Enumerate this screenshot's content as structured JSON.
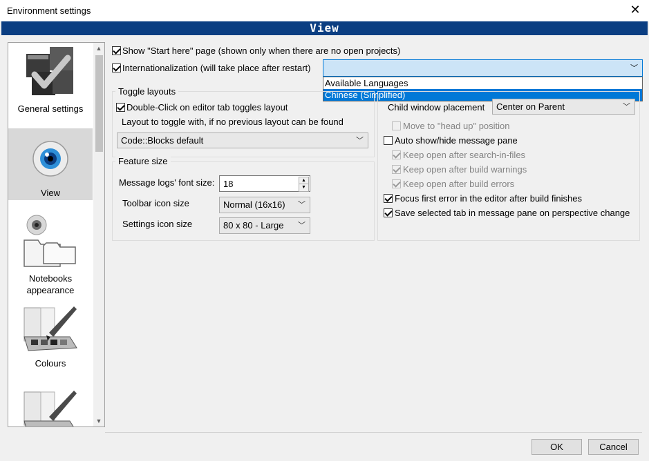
{
  "window": {
    "title": "Environment settings",
    "close_glyph": "✕"
  },
  "banner": {
    "title": "View"
  },
  "sidebar": {
    "items": [
      {
        "label": "General settings",
        "icon": "general-settings-icon"
      },
      {
        "label": "View",
        "icon": "view-eye-icon",
        "selected": true
      },
      {
        "label": "Notebooks appearance",
        "icon": "notebooks-appearance-icon"
      },
      {
        "label": "Colours",
        "icon": "colours-palette-icon"
      },
      {
        "label": "",
        "icon": "palette-icon"
      }
    ]
  },
  "main": {
    "show_start_here": {
      "label": "Show \"Start here\" page (shown only when there are no open projects)",
      "checked": true
    },
    "internationalization": {
      "label": "Internationalization (will take place after restart)",
      "checked": true,
      "value": ""
    },
    "language_dropdown": {
      "options": [
        "Available Languages",
        "Chinese (Simplified)"
      ],
      "highlighted": "Chinese (Simplified)"
    },
    "toggle_layouts": {
      "legend": "Toggle layouts",
      "double_click": {
        "label": "Double-Click on editor tab toggles layout",
        "checked": true
      },
      "layout_label": "Layout to toggle with, if no previous layout can be found",
      "layout_value": "Code::Blocks default"
    },
    "feature_size": {
      "legend": "Feature size",
      "font_size_label": "Message logs' font size:",
      "font_size_value": "18",
      "toolbar_icon_label": "Toolbar icon size",
      "toolbar_icon_value": "Normal (16x16)",
      "settings_icon_label": "Settings icon size",
      "settings_icon_value": "80 x 80 - Large"
    },
    "right": {
      "child_window_label": "Child window placement",
      "child_window_value": "Center on Parent",
      "move_head_up": {
        "label": "Move to \"head up\" position",
        "checked": false,
        "disabled": true
      },
      "auto_show_hide": {
        "label": "Auto show/hide message pane",
        "checked": false
      },
      "keep_search": {
        "label": "Keep open after search-in-files",
        "checked": true,
        "disabled": true
      },
      "keep_warnings": {
        "label": "Keep open after build warnings",
        "checked": true,
        "disabled": true
      },
      "keep_errors": {
        "label": "Keep open after build errors",
        "checked": true,
        "disabled": true
      },
      "focus_first_error": {
        "label": "Focus first error in the editor after build finishes",
        "checked": true
      },
      "save_selected_tab": {
        "label": "Save selected tab in message pane on perspective change",
        "checked": true
      }
    }
  },
  "buttons": {
    "ok": "OK",
    "cancel": "Cancel"
  },
  "colors": {
    "banner": "#0b3e82",
    "highlight": "#0078d7"
  }
}
